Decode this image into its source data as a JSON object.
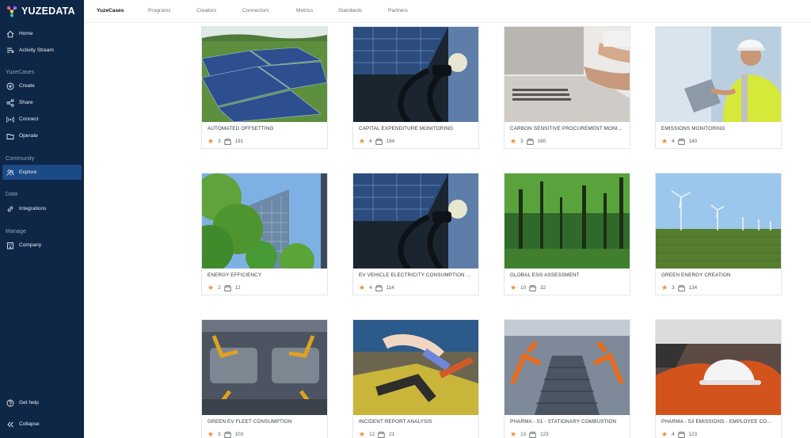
{
  "brand": {
    "name": "YUZEDATA"
  },
  "sidebar": {
    "top_items": [
      {
        "label": "Home",
        "icon": "home-icon"
      },
      {
        "label": "Activity Stream",
        "icon": "activity-stream-icon"
      }
    ],
    "sections": [
      {
        "title": "YuzeCases",
        "items": [
          {
            "label": "Create",
            "icon": "plus-circle-icon"
          },
          {
            "label": "Share",
            "icon": "share-icon"
          },
          {
            "label": "Connect",
            "icon": "broadcast-icon"
          },
          {
            "label": "Operate",
            "icon": "folder-icon"
          }
        ]
      },
      {
        "title": "Community",
        "items": [
          {
            "label": "Explore",
            "icon": "users-icon",
            "active": true
          }
        ]
      },
      {
        "title": "Data",
        "items": [
          {
            "label": "Integrations",
            "icon": "link-icon"
          }
        ]
      },
      {
        "title": "Manage",
        "items": [
          {
            "label": "Company",
            "icon": "building-icon"
          }
        ]
      }
    ],
    "bottom_items": [
      {
        "label": "Get help",
        "icon": "help-icon"
      },
      {
        "label": "Collapse",
        "icon": "collapse-icon"
      }
    ]
  },
  "topnav": {
    "tabs": [
      "YuzeCases",
      "Programs",
      "Creators",
      "Connectors",
      "Metrics",
      "Standards",
      "Partners"
    ],
    "active": "YuzeCases"
  },
  "cards": [
    {
      "title": "AUTOMATED OFFSETTING",
      "rating": "3",
      "count": "191",
      "image": "solar-panels-field"
    },
    {
      "title": "CAPITAL EXPENDITURE MONITORING",
      "rating": "4",
      "count": "194",
      "image": "ev-charger"
    },
    {
      "title": "CARBON SENSITIVE PROCUREMENT MONI...",
      "rating": "3",
      "count": "180",
      "image": "laptop-desk"
    },
    {
      "title": "EMISSIONS MONITORING",
      "rating": "4",
      "count": "140",
      "image": "engineer-tablet"
    },
    {
      "title": "ENERGY EFFICIENCY",
      "rating": "2",
      "count": "12",
      "image": "green-building"
    },
    {
      "title": "EV VEHICLE ELECTRICITY CONSUMPTION ...",
      "rating": "4",
      "count": "114",
      "image": "ev-charger"
    },
    {
      "title": "GLOBAL ESG ASSESSMENT",
      "rating": "10",
      "count": "32",
      "image": "forest"
    },
    {
      "title": "GREEN ENERGY CREATION",
      "rating": "3",
      "count": "134",
      "image": "wind-turbines"
    },
    {
      "title": "GREEN EV FLEET CONSUMPTION",
      "rating": "3",
      "count": "103",
      "image": "car-factory-robots"
    },
    {
      "title": "INCIDENT REPORT ANALYSIS",
      "rating": "12",
      "count": "21",
      "image": "first-aid-rescue"
    },
    {
      "title": "PHARMA - S1 - STATIONARY COMBUSTION",
      "rating": "13",
      "count": "123",
      "image": "assembly-line"
    },
    {
      "title": "PHARMA - S3 EMISSIONS - EMPLOYEE CO...",
      "rating": "4",
      "count": "123",
      "image": "hard-hat-car"
    }
  ],
  "colors": {
    "sidebar_bg": "#0e2746",
    "sidebar_active": "#1c4a86",
    "star": "#f08c2e"
  }
}
